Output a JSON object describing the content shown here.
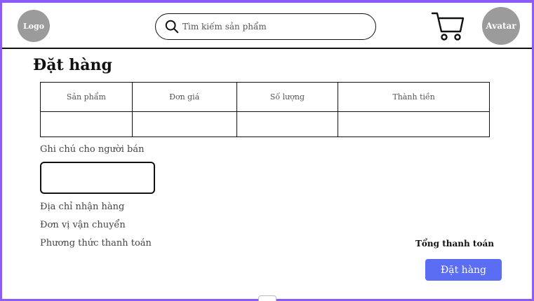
{
  "header": {
    "logo_label": "Logo",
    "search_placeholder": "Tìm kiếm sản phẩm",
    "avatar_label": "Avatar"
  },
  "page": {
    "title": "Đặt hàng"
  },
  "order_table": {
    "columns": [
      "Sản phẩm",
      "Đơn giá",
      "Số lượng",
      "Thành tiền"
    ]
  },
  "note": {
    "label": "Ghi chú cho người bán"
  },
  "info_rows": [
    "Địa chỉ nhận hàng",
    "Đơn vị vận chuyển",
    "Phương thức thanh toán"
  ],
  "summary": {
    "total_label": "Tổng thanh toán",
    "submit_label": "Đặt hàng"
  },
  "colors": {
    "frame": "#8b5cf6",
    "placeholder_circle": "#9b9b9b",
    "primary_button": "#5b6df2"
  },
  "icons": [
    "search-icon",
    "cart-icon"
  ]
}
